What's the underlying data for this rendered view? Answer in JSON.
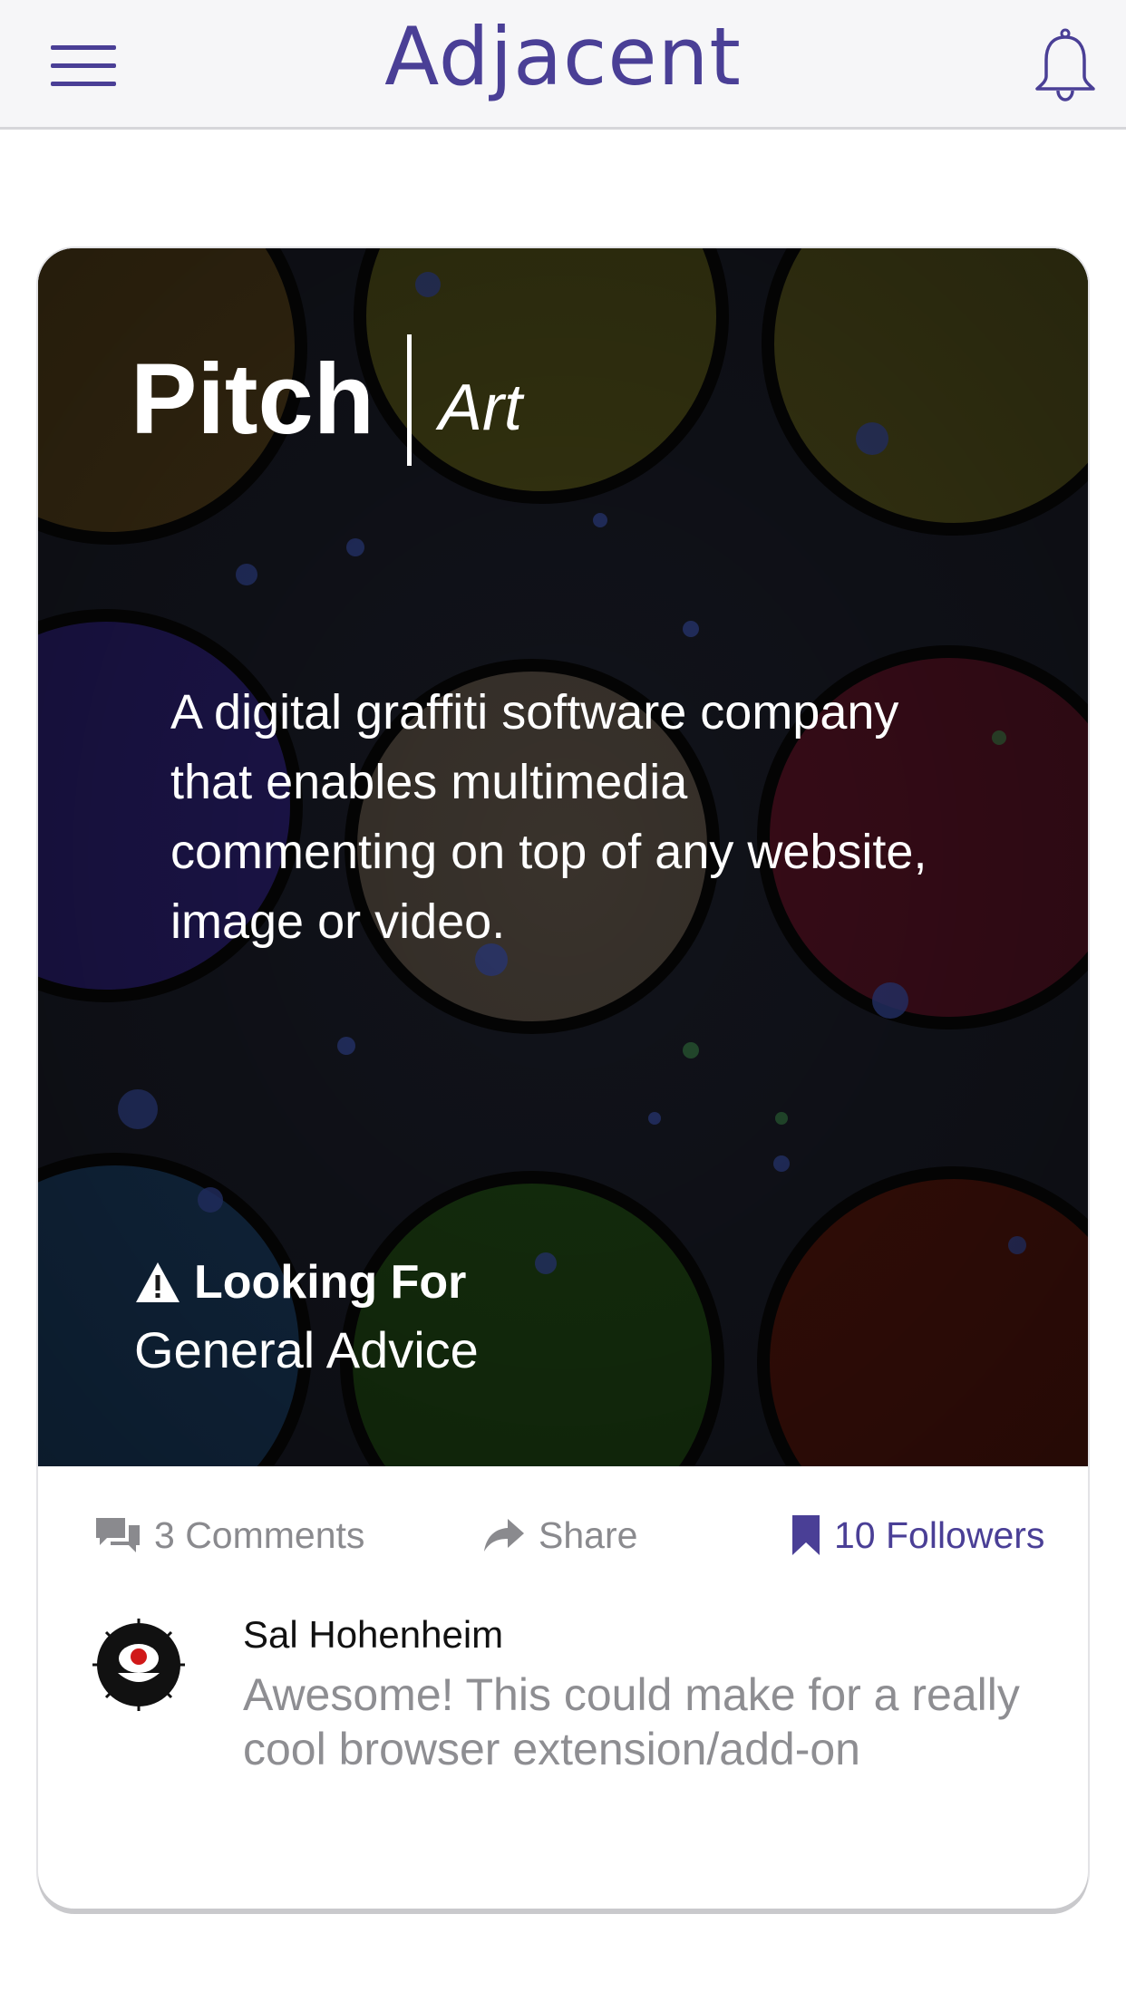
{
  "header": {
    "logo": "Adjacent",
    "menu_icon": "hamburger-menu-icon",
    "notification_icon": "bell-icon",
    "accent_color": "#4a3f96"
  },
  "card": {
    "title": "Pitch",
    "category": "Art",
    "description": "A digital graffiti software company that enables multimedia commenting on top of any website, image or video.",
    "looking_for_label": "Looking For",
    "looking_for_icon": "warning-icon",
    "looking_for_value": "General Advice",
    "actions": {
      "comments": "3 Comments",
      "comments_icon": "comments-icon",
      "share": "Share",
      "share_icon": "share-arrow-icon",
      "followers": "10 Followers",
      "followers_icon": "bookmark-icon"
    },
    "latest_comment": {
      "author": "Sal Hohenheim",
      "text": "Awesome! This could make for a really cool browser extension/add-on"
    }
  }
}
